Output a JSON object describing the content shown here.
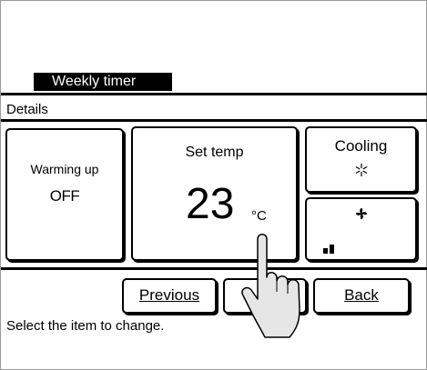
{
  "screen": {
    "title": "Weekly timer",
    "section": "Details",
    "hint": "Select the item to change."
  },
  "warming": {
    "label": "Warming up",
    "value": "OFF"
  },
  "set_temp": {
    "label": "Set temp",
    "value": "23",
    "unit": "°C"
  },
  "mode": {
    "label": "Cooling",
    "icon": "snowflake-icon"
  },
  "fan": {
    "icon": "fan-icon",
    "level_icon": "fan-speed-bars-icon",
    "level": 2,
    "levels": 4
  },
  "buttons": {
    "previous": "Previous",
    "next": "",
    "back": "Back"
  }
}
